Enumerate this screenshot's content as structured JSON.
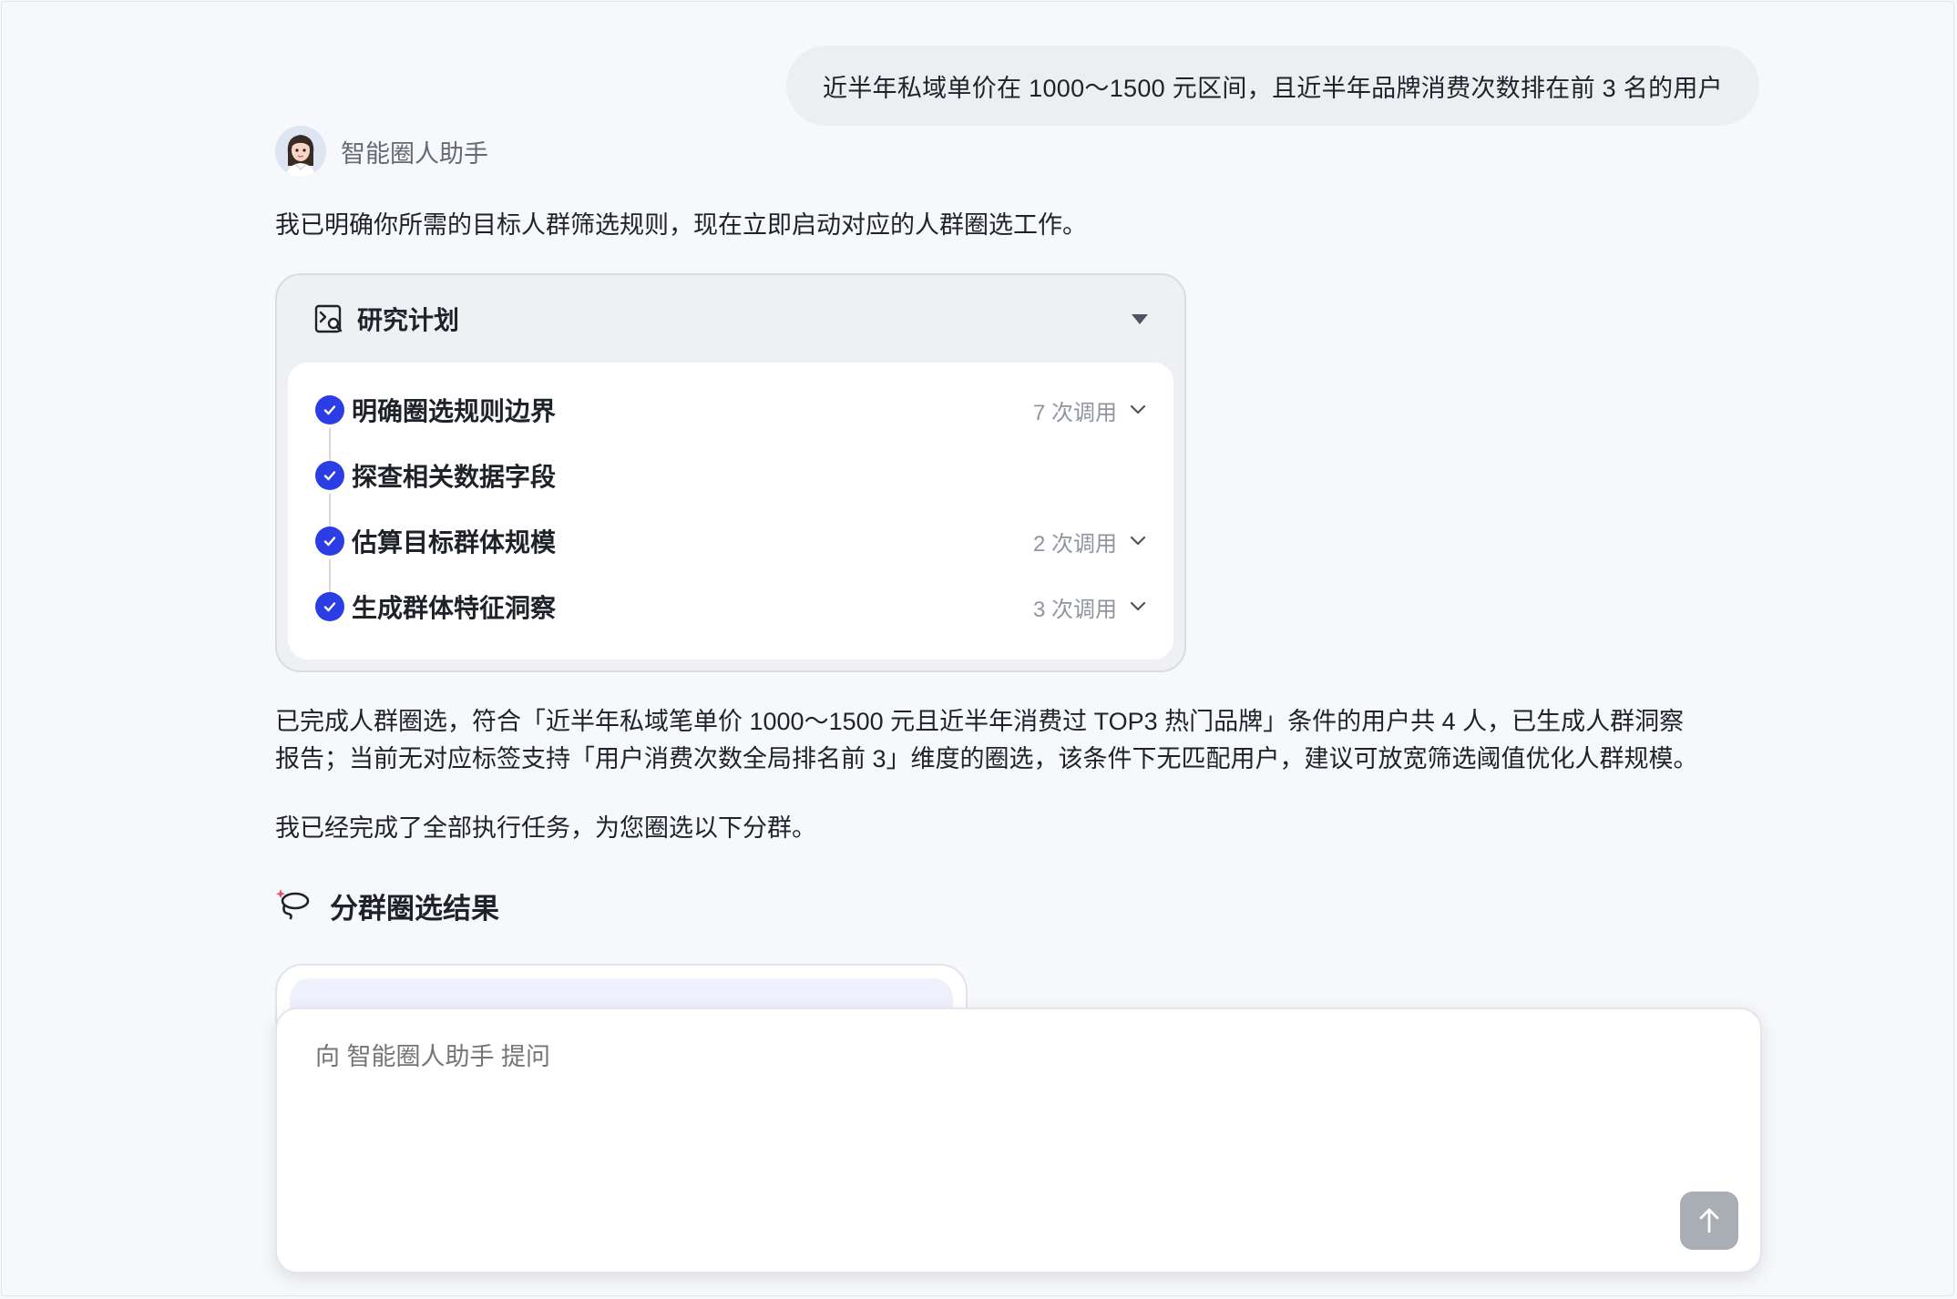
{
  "user_message": "近半年私域单价在 1000～1500 元区间，且近半年品牌消费次数排在前 3 名的用户",
  "assistant": {
    "name": "智能圈人助手",
    "intro": "我已明确你所需的目标人群筛选规则，现在立即启动对应的人群圈选工作。"
  },
  "plan": {
    "title": "研究计划",
    "steps": [
      {
        "label": "明确圈选规则边界",
        "calls": "7 次调用"
      },
      {
        "label": "探查相关数据字段",
        "calls": ""
      },
      {
        "label": "估算目标群体规模",
        "calls": "2 次调用"
      },
      {
        "label": "生成群体特征洞察",
        "calls": "3 次调用"
      }
    ]
  },
  "summary": {
    "line1": "已完成人群圈选，符合「近半年私域笔单价 1000～1500 元且近半年消费过 TOP3 热门品牌」条件的用户共 4 人，已生成人群洞察",
    "line2": "报告；当前无对应标签支持「用户消费次数全局排名前 3」维度的圈选，该条件下无匹配用户，建议可放宽筛选阈值优化人群规模。"
  },
  "completion": "我已经完成了全部执行任务，为您圈选以下分群。",
  "result_section": {
    "title": "分群圈选结果"
  },
  "composer": {
    "placeholder": "向 智能圈人助手 提问"
  },
  "colors": {
    "accent": "#2b3ee6",
    "send_disabled": "#a9adb4"
  }
}
